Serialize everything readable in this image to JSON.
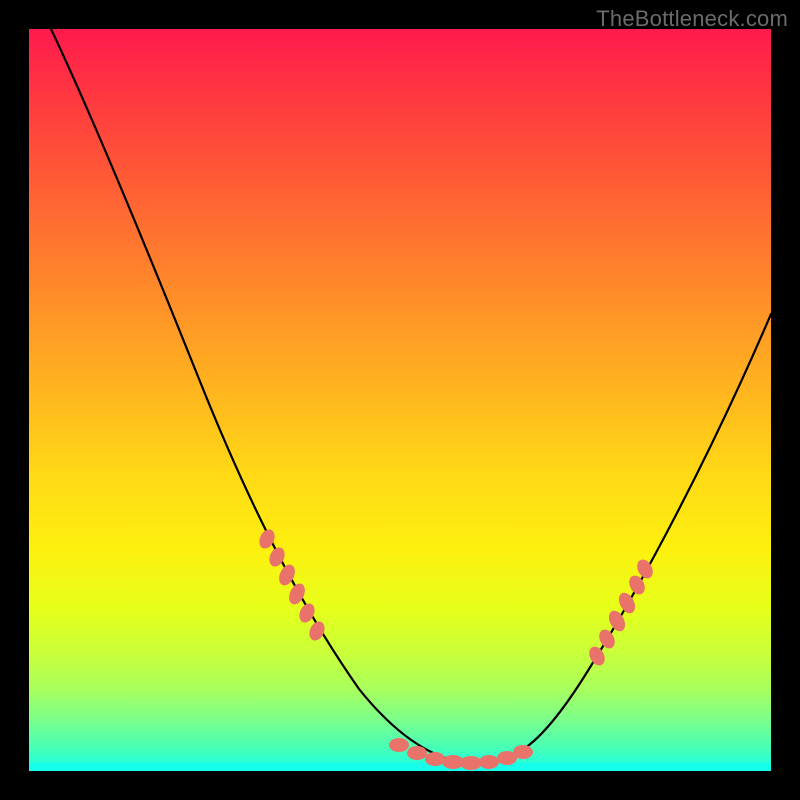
{
  "watermark": "TheBottleneck.com",
  "chart_data": {
    "type": "line",
    "title": "",
    "xlabel": "",
    "ylabel": "",
    "xlim": [
      0,
      100
    ],
    "ylim": [
      0,
      100
    ],
    "series": [
      {
        "name": "curve",
        "x": [
          3,
          8,
          14,
          20,
          26,
          33,
          39,
          45,
          50,
          54,
          57,
          60,
          63,
          66,
          69,
          73,
          78,
          84,
          90,
          96,
          100
        ],
        "y": [
          100,
          90,
          79,
          68,
          57,
          44,
          32,
          20,
          12,
          7,
          4,
          2,
          2,
          3,
          6,
          11,
          19,
          30,
          42,
          54,
          62
        ]
      }
    ],
    "markers": [
      {
        "name": "left-cluster",
        "x_range": [
          22,
          28
        ],
        "y_range": [
          14,
          20
        ]
      },
      {
        "name": "bottom-cluster",
        "x_range": [
          50,
          66
        ],
        "y_range": [
          2,
          5
        ]
      },
      {
        "name": "right-cluster",
        "x_range": [
          66,
          70
        ],
        "y_range": [
          12,
          20
        ]
      }
    ],
    "background": {
      "gradient_type": "vertical",
      "stops": [
        {
          "pos": 0,
          "color": "#ff1a4d"
        },
        {
          "pos": 50,
          "color": "#ffb91e"
        },
        {
          "pos": 100,
          "color": "#17ffea"
        }
      ]
    },
    "frame": {
      "border_color": "#000000",
      "border_px": 29
    }
  }
}
